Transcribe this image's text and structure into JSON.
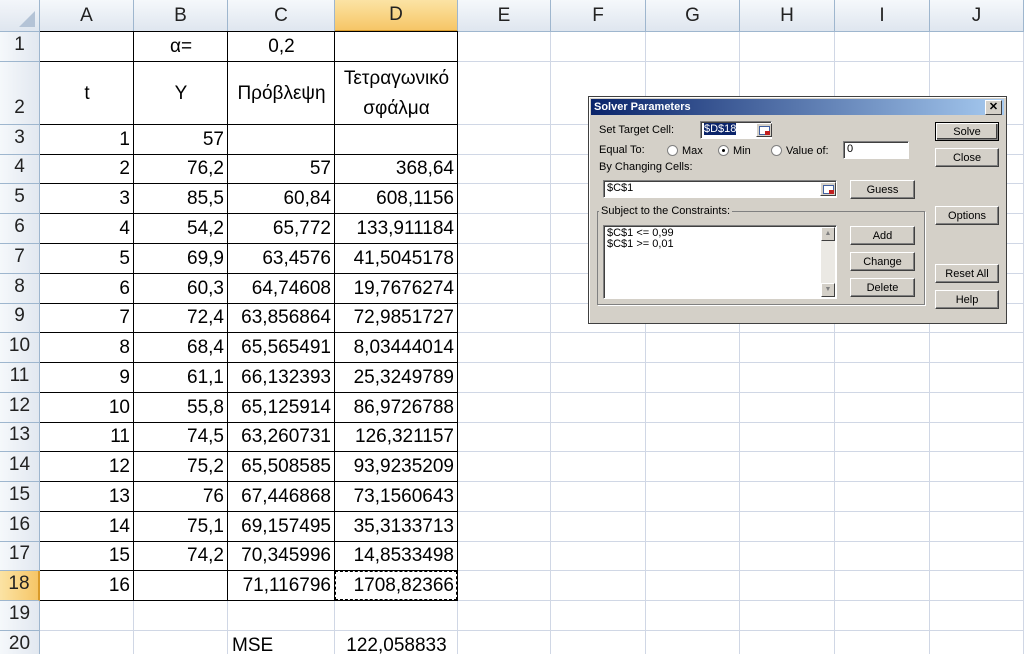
{
  "spreadsheet": {
    "columns": [
      "A",
      "B",
      "C",
      "D",
      "E",
      "F",
      "G",
      "H",
      "I",
      "J"
    ],
    "selected_column": "D",
    "selected_row": "18",
    "row_numbers": [
      "1",
      "2",
      "3",
      "4",
      "5",
      "6",
      "7",
      "8",
      "9",
      "10",
      "11",
      "12",
      "13",
      "14",
      "15",
      "16",
      "17",
      "18",
      "19",
      "20"
    ],
    "cells": {
      "B1": "α=",
      "C1": "0,2",
      "A2": "t",
      "B2": "Y",
      "C2": "Πρόβλεψη",
      "D2": "Τετραγωνικό σφάλμα",
      "A3": "1",
      "B3": "57",
      "A4": "2",
      "B4": "76,2",
      "C4": "57",
      "D4": "368,64",
      "A5": "3",
      "B5": "85,5",
      "C5": "60,84",
      "D5": "608,1156",
      "A6": "4",
      "B6": "54,2",
      "C6": "65,772",
      "D6": "133,911184",
      "A7": "5",
      "B7": "69,9",
      "C7": "63,4576",
      "D7": "41,5045178",
      "A8": "6",
      "B8": "60,3",
      "C8": "64,74608",
      "D8": "19,7676274",
      "A9": "7",
      "B9": "72,4",
      "C9": "63,856864",
      "D9": "72,9851727",
      "A10": "8",
      "B10": "68,4",
      "C10": "65,565491",
      "D10": "8,03444014",
      "A11": "9",
      "B11": "61,1",
      "C11": "66,132393",
      "D11": "25,3249789",
      "A12": "10",
      "B12": "55,8",
      "C12": "65,125914",
      "D12": "86,9726788",
      "A13": "11",
      "B13": "74,5",
      "C13": "63,260731",
      "D13": "126,321157",
      "A14": "12",
      "B14": "75,2",
      "C14": "65,508585",
      "D14": "93,9235209",
      "A15": "13",
      "B15": "76",
      "C15": "67,446868",
      "D15": "73,1560643",
      "A16": "14",
      "B16": "75,1",
      "C16": "69,157495",
      "D16": "35,3133713",
      "A17": "15",
      "B17": "74,2",
      "C17": "70,345996",
      "D17": "14,8533498",
      "A18": "16",
      "C18": "71,116796",
      "D18": "1708,82366",
      "C20": "MSE",
      "D20": "122,058833"
    }
  },
  "solver_dialog": {
    "title": "Solver Parameters",
    "close_glyph": "✕",
    "set_target_cell_label": "Set Target Cell:",
    "target_cell_value": "$D$18",
    "equal_to_label": "Equal To:",
    "opt_max": "Max",
    "opt_min": "Min",
    "opt_value_of": "Value of:",
    "selected_option": "Min",
    "value_of_value": "0",
    "by_changing_cells_label": "By Changing Cells:",
    "changing_cells_value": "$C$1",
    "guess_button": "Guess",
    "constraints_label": "Subject to the Constraints:",
    "constraints": [
      "$C$1 <= 0,99",
      "$C$1 >= 0,01"
    ],
    "add_button": "Add",
    "change_button": "Change",
    "delete_button": "Delete",
    "solve_button": "Solve",
    "close_button": "Close",
    "options_button": "Options",
    "reset_all_button": "Reset All",
    "help_button": "Help",
    "colors": {
      "title_start": "#0a246a",
      "title_end": "#a6caf0",
      "face": "#d4d0c8"
    }
  }
}
